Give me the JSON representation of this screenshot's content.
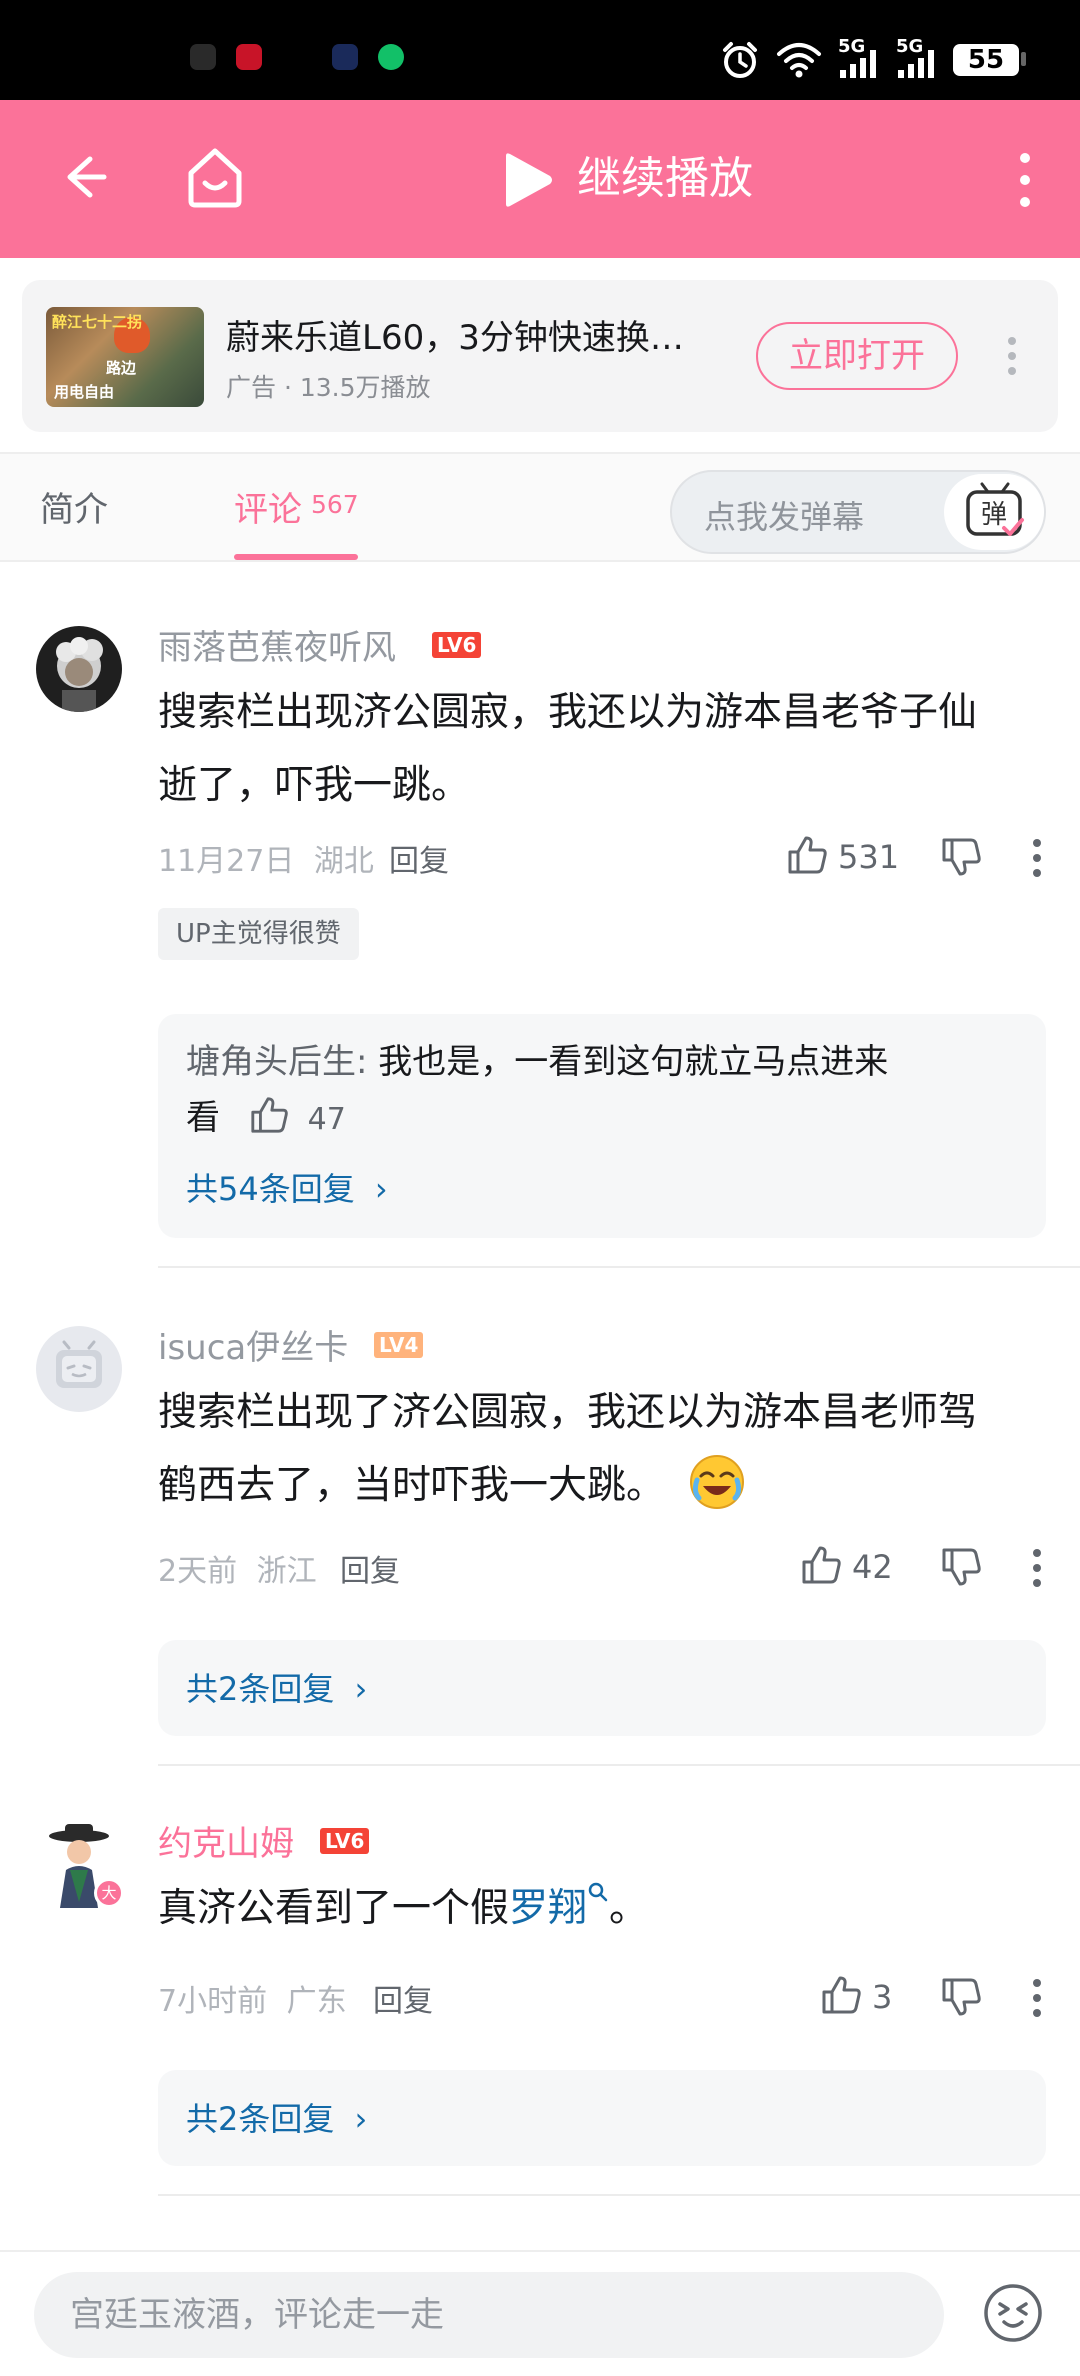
{
  "status_bar": {
    "net1": "5G",
    "net2": "5G",
    "battery": "55"
  },
  "header": {
    "title": "继续播放"
  },
  "ad": {
    "thumb_text_top": "醉江七十二拐",
    "thumb_text_mid": "路边",
    "thumb_text_bottom": "用电自由",
    "title": "蔚来乐道L60，3分钟快速换…",
    "subtitle": "广告 · 13.5万播放",
    "open_label": "立即打开"
  },
  "tabs": {
    "intro": "简介",
    "comments": "评论",
    "comments_count": "567",
    "danmaku_placeholder": "点我发弹幕",
    "danmaku_icon_label": "弹"
  },
  "comments": [
    {
      "username": "雨落芭蕉夜听风",
      "level": "LV6",
      "text_line1": "搜索栏出现济公圆寂，我还以为游本昌老爷子仙",
      "text_line2": "逝了，吓我一跳。",
      "date": "11月27日",
      "location": "湖北",
      "reply_label": "回复",
      "likes": "531",
      "up_badge": "UP主觉得很赞",
      "sub_reply": {
        "user": "塘角头后生:",
        "text_line1": " 我也是，一看到这句就立马点进来",
        "text_line2": "看",
        "likes": "47"
      },
      "more_replies": "共54条回复"
    },
    {
      "username": "isuca伊丝卡",
      "level": "LV4",
      "text_line1": "搜索栏出现了济公圆寂，我还以为游本昌老师驾",
      "text_line2": "鹤西去了，当时吓我一大跳。",
      "date": "2天前",
      "location": "浙江",
      "reply_label": "回复",
      "likes": "42",
      "more_replies": "共2条回复"
    },
    {
      "username": "约克山姆",
      "level": "LV6",
      "text_before_link": "真济公看到了一个假",
      "text_link": "罗翔",
      "text_after_link": "。",
      "date": "7小时前",
      "location": "广东",
      "reply_label": "回复",
      "likes": "3",
      "more_replies": "共2条回复",
      "avatar_badge": "大"
    }
  ],
  "bottom": {
    "placeholder": "宫廷玉液酒，评论走一走"
  },
  "colors": {
    "brand_pink": "#fb7299",
    "link_blue": "#136aa8",
    "lv6_red": "#f44336",
    "lv4_orange": "#ffb37c"
  }
}
